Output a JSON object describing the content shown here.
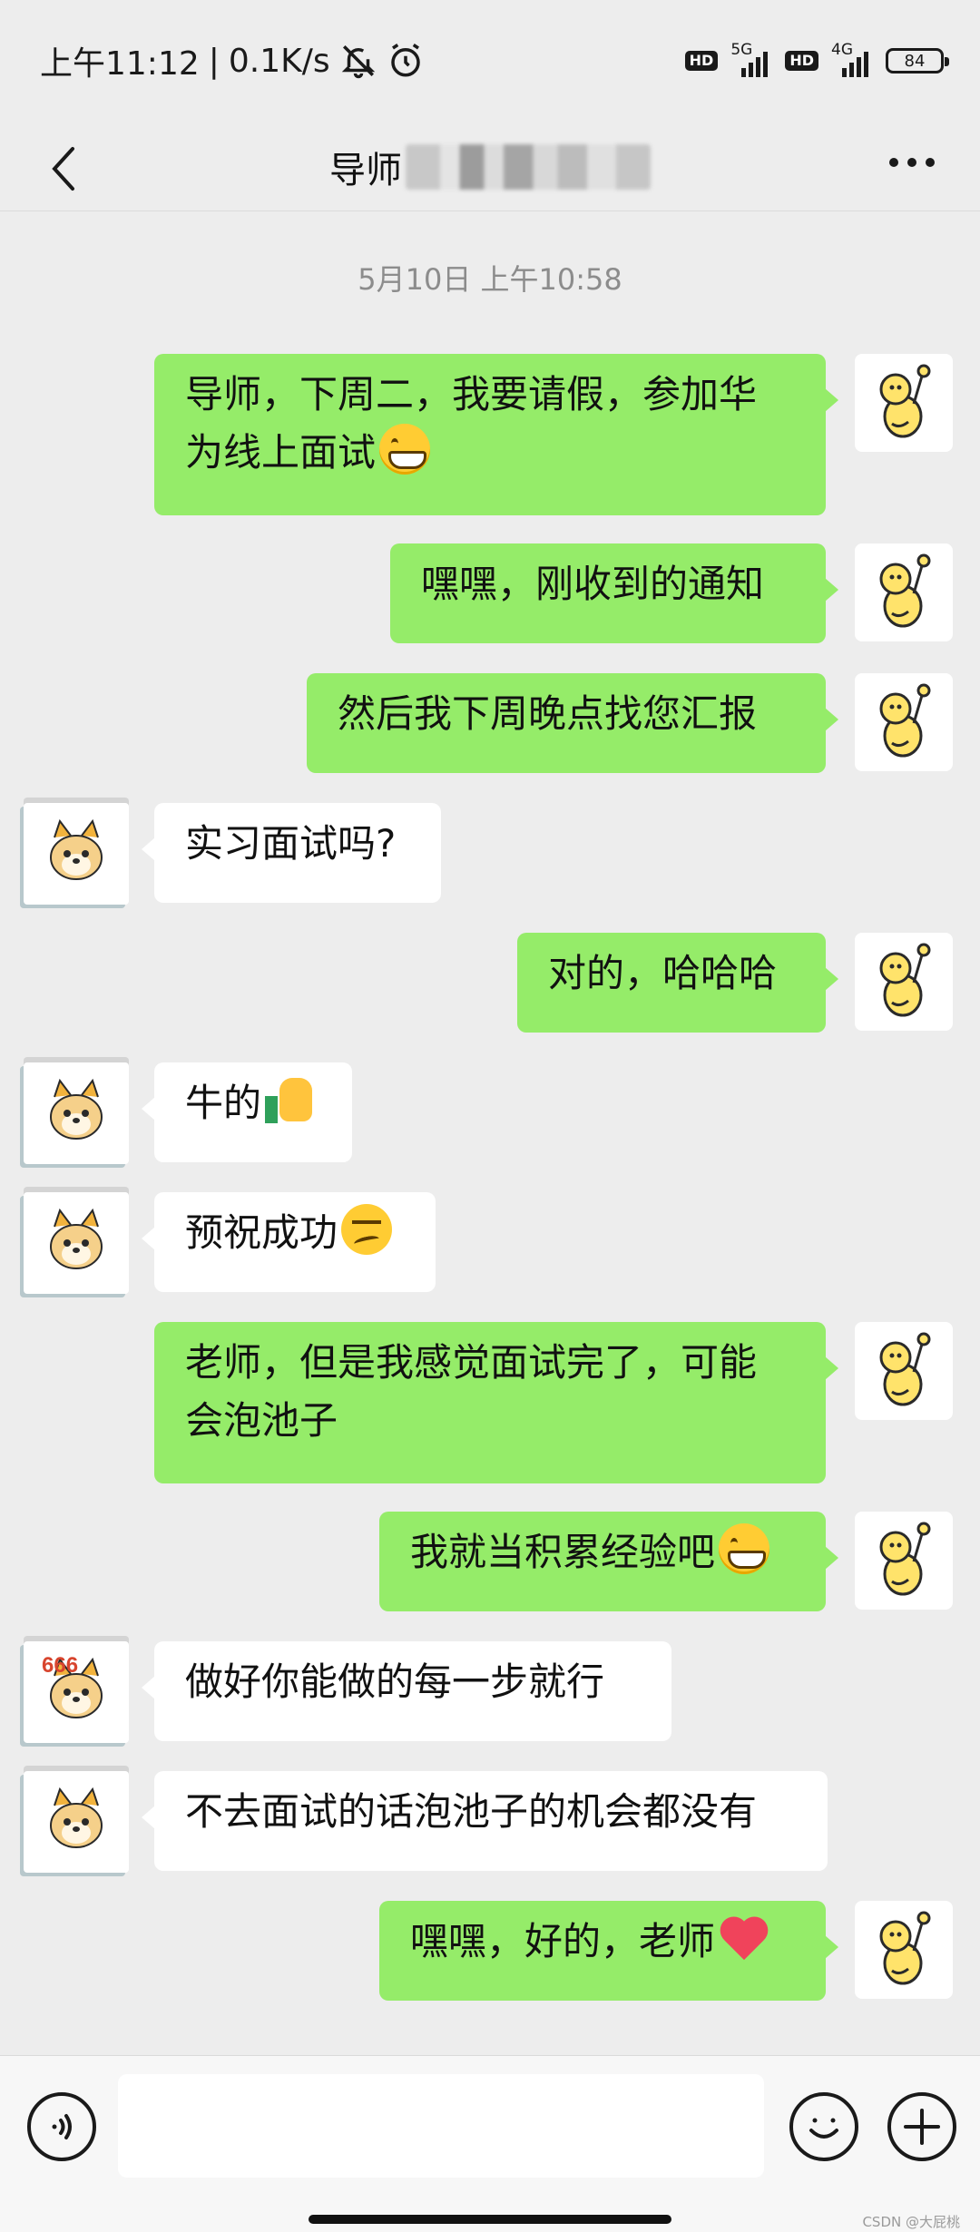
{
  "status_bar": {
    "time": "上午11:12",
    "separator": "|",
    "net_speed": "0.1K/s",
    "sim1_hd": "HD",
    "sim1_type": "5G",
    "sim2_hd": "HD",
    "sim2_type": "4G",
    "battery": "84",
    "icons": [
      "bell-off-icon",
      "alarm-clock-icon",
      "signal-icon",
      "battery-icon"
    ]
  },
  "nav": {
    "back_icon": "chevron-left-icon",
    "title": "导师",
    "more_icon": "more-horizontal-icon"
  },
  "chat": {
    "timestamp": "5月10日 上午10:58",
    "messages": [
      {
        "side": "right",
        "lines": [
          "导师，下周二，我要请假，参加华",
          "为线上面试"
        ],
        "emoji": "grin"
      },
      {
        "side": "right",
        "lines": [
          "嘿嘿，刚收到的通知"
        ],
        "emoji": ""
      },
      {
        "side": "right",
        "lines": [
          "然后我下周晚点找您汇报"
        ],
        "emoji": ""
      },
      {
        "side": "left",
        "lines": [
          "实习面试吗?"
        ],
        "emoji": ""
      },
      {
        "side": "right",
        "lines": [
          "对的，哈哈哈"
        ],
        "emoji": ""
      },
      {
        "side": "left",
        "lines": [
          "牛的"
        ],
        "emoji": "thumbs-up"
      },
      {
        "side": "left",
        "lines": [
          "预祝成功"
        ],
        "emoji": "smirk"
      },
      {
        "side": "right",
        "lines": [
          "老师，但是我感觉面试完了，可能",
          "会泡池子"
        ],
        "emoji": ""
      },
      {
        "side": "right",
        "lines": [
          "我就当积累经验吧"
        ],
        "emoji": "grin"
      },
      {
        "side": "left",
        "lines": [
          "做好你能做的每一步就行"
        ],
        "emoji": "",
        "avatar_text": "666"
      },
      {
        "side": "left",
        "lines": [
          "不去面试的话泡池子的机会都没有"
        ],
        "emoji": ""
      },
      {
        "side": "right",
        "lines": [
          "嘿嘿，好的，老师"
        ],
        "emoji": "heart"
      }
    ]
  },
  "input_bar": {
    "voice_icon": "voice-icon",
    "input_value": "",
    "emoji_icon": "emoji-icon",
    "plus_icon": "plus-icon"
  },
  "watermark": "CSDN @大屁桃",
  "colors": {
    "background": "#ededed",
    "outgoing_bubble": "#95ec69",
    "incoming_bubble": "#ffffff",
    "heart": "#f0435b"
  }
}
